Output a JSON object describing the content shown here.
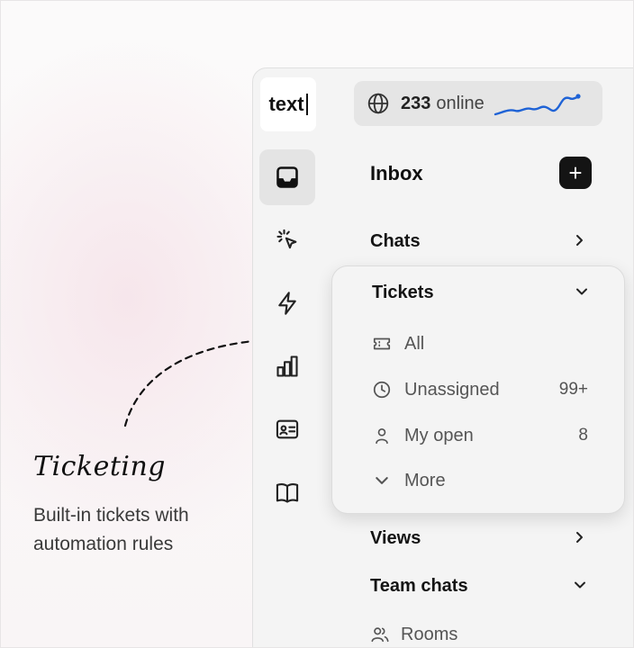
{
  "feature": {
    "title": "Ticketing",
    "description": "Built-in tickets with automation rules"
  },
  "app": {
    "logo_text": "text",
    "online": {
      "count": "233",
      "label": "online"
    },
    "inbox": {
      "title": "Inbox",
      "add_label": "+"
    },
    "sections": {
      "chats": "Chats",
      "views": "Views",
      "team_chats": "Team chats"
    },
    "tickets": {
      "title": "Tickets",
      "items": [
        {
          "label": "All",
          "count": "",
          "icon": "ticket-icon"
        },
        {
          "label": "Unassigned",
          "count": "99+",
          "icon": "clock-icon"
        },
        {
          "label": "My open",
          "count": "8",
          "icon": "user-icon"
        },
        {
          "label": "More",
          "count": "",
          "icon": "chevron-down-icon"
        }
      ]
    },
    "team_chats_items": [
      {
        "label": "Rooms",
        "icon": "users-icon"
      }
    ],
    "nav": [
      {
        "name": "inbox",
        "icon": "inbox-icon",
        "active": true
      },
      {
        "name": "automation",
        "icon": "click-icon",
        "active": false
      },
      {
        "name": "workflows",
        "icon": "lightning-icon",
        "active": false
      },
      {
        "name": "reports",
        "icon": "bar-chart-icon",
        "active": false
      },
      {
        "name": "contacts",
        "icon": "contact-card-icon",
        "active": false
      },
      {
        "name": "knowledge",
        "icon": "book-icon",
        "active": false
      }
    ]
  },
  "colors": {
    "accent_sparkline": "#1f63d6",
    "dark_button": "#141414"
  }
}
